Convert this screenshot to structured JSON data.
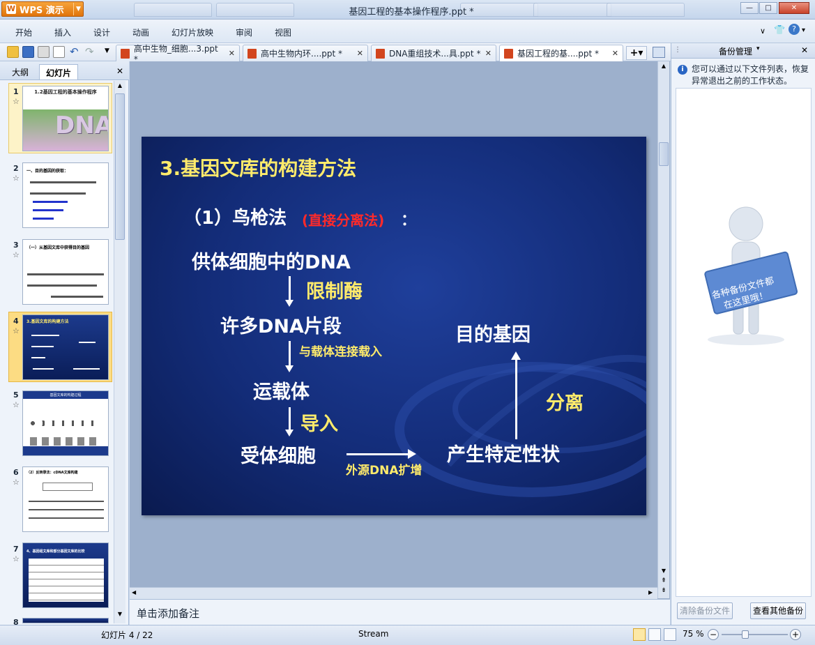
{
  "window": {
    "app_button": "WPS 演示",
    "title": "基因工程的基本操作程序.ppt *",
    "minimize": "—",
    "maximize": "□",
    "close": "✕"
  },
  "menu": [
    "开始",
    "插入",
    "设计",
    "动画",
    "幻灯片放映",
    "审阅",
    "视图"
  ],
  "doc_tabs": [
    {
      "label": "高中生物_细胞...3.ppt *",
      "close": "✕"
    },
    {
      "label": "高中生物内环....ppt *",
      "close": "✕"
    },
    {
      "label": "DNA重组技术...具.ppt *",
      "close": "✕"
    },
    {
      "label": "基因工程的基....ppt *",
      "close": "✕"
    }
  ],
  "left_panel": {
    "tabs": [
      "大纲",
      "幻灯片"
    ],
    "close": "✕",
    "thumb_numbers": [
      "1",
      "2",
      "3",
      "4",
      "5",
      "6",
      "7",
      "8"
    ],
    "thumb1_title": "1.2基因工程的基本操作程序",
    "thumb1_dna": "DNA",
    "thumb2_title": "一、目的基因的获取：",
    "thumb3_title": "（一）从基因文库中获得目的基因",
    "thumb4_title": "3.基因文库的构建方法",
    "thumb5_title": "基因文库的构建过程",
    "thumb6_title": "（2）反转录法：cDNA文库构建",
    "thumb7_title": "4、基因组文库和部分基因文库的比较"
  },
  "slide": {
    "heading": "3.基因文库的构建方法",
    "subheading_a": "（1）鸟枪法",
    "subheading_b": "(直接分离法)",
    "subheading_c": "：",
    "step1": "供体细胞中的DNA",
    "enzyme": "限制酶",
    "step2": "许多DNA片段",
    "connect": "与载体连接载入",
    "step3": "运载体",
    "import": "导入",
    "step4": "受体细胞",
    "amplify": "外源DNA扩增",
    "trait": "产生特定性状",
    "separate": "分离",
    "target": "目的基因"
  },
  "notes_placeholder": "单击添加备注",
  "right_panel": {
    "title": "备份管理",
    "close": "✕",
    "info": "您可以通过以下文件列表，恢复异常退出之前的工作状态。",
    "sign_text": "各种备份文件都在这里哦！",
    "btn_clear": "清除备份文件",
    "btn_more": "查看其他备份"
  },
  "status": {
    "slide_pos": "幻灯片 4 / 22",
    "theme": "Stream",
    "zoom": "75 %"
  }
}
